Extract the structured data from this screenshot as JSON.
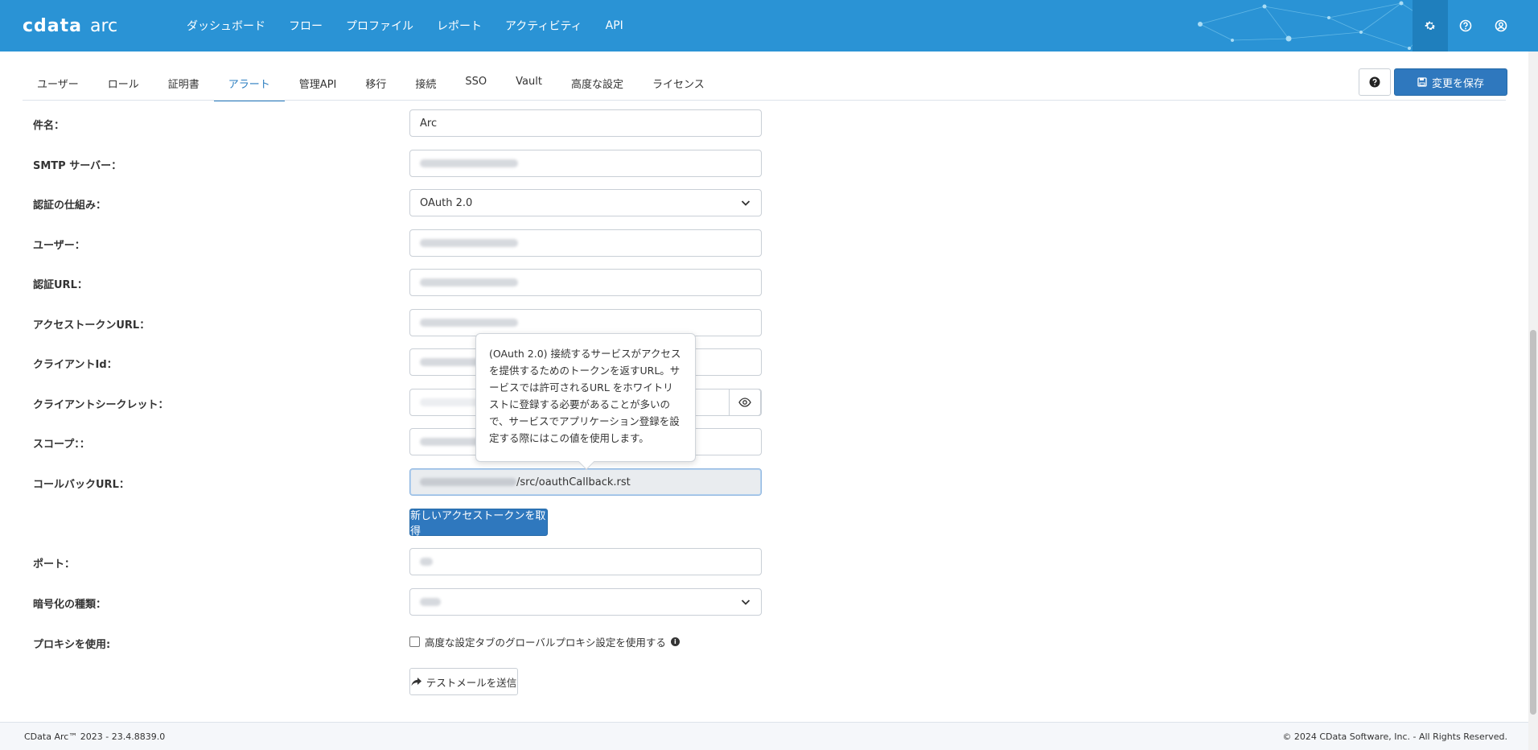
{
  "app": {
    "logo_main": "cdata",
    "logo_sub": "arc"
  },
  "nav": [
    {
      "label": "ダッシュボード"
    },
    {
      "label": "フロー"
    },
    {
      "label": "プロファイル"
    },
    {
      "label": "レポート"
    },
    {
      "label": "アクティビティ"
    },
    {
      "label": "API"
    }
  ],
  "subtabs": [
    {
      "label": "ユーザー"
    },
    {
      "label": "ロール"
    },
    {
      "label": "証明書"
    },
    {
      "label": "アラート",
      "active": true
    },
    {
      "label": "管理API"
    },
    {
      "label": "移行"
    },
    {
      "label": "接続"
    },
    {
      "label": "SSO"
    },
    {
      "label": "Vault"
    },
    {
      "label": "高度な設定"
    },
    {
      "label": "ライセンス"
    }
  ],
  "toolbar": {
    "save_label": "変更を保存"
  },
  "form": {
    "subject": {
      "label": "件名：",
      "value": "Arc"
    },
    "smtp": {
      "label": "SMTP サーバー："
    },
    "auth_mech": {
      "label": "認証の仕組み：",
      "value": "OAuth 2.0"
    },
    "user": {
      "label": "ユーザー："
    },
    "auth_url": {
      "label": "認証URL："
    },
    "token_url": {
      "label": "アクセストークンURL："
    },
    "client_id": {
      "label": "クライアントId："
    },
    "client_secret": {
      "label": "クライアントシークレット："
    },
    "scope": {
      "label": "スコープ：："
    },
    "callback_url": {
      "label": "コールバックURL：",
      "value_suffix": "/src/oauthCallback.rst"
    },
    "token_button": "新しいアクセストークンを取得",
    "port": {
      "label": "ポート："
    },
    "encryption": {
      "label": "暗号化の種類："
    },
    "proxy": {
      "label": "プロキシを使用:",
      "checkbox_label": "高度な設定タブのグローバルプロキシ設定を使用する"
    },
    "test_button": "テストメールを送信"
  },
  "tooltip": {
    "text": "(OAuth 2.0) 接続するサービスがアクセスを提供するためのトークンを返すURL。サービスでは許可されるURL をホワイトリストに登録する必要があることが多いので、サービスでアプリケーション登録を設定する際にはこの値を使用します。"
  },
  "footer": {
    "left": "CData Arc™ 2023 - 23.4.8839.0",
    "right": "© 2024 CData Software, Inc. - All Rights Reserved."
  },
  "colors": {
    "topbar": "#2a93d5",
    "primary_button": "#2f78be",
    "active_tab": "#2a7dc0"
  },
  "icons": [
    "gear-icon",
    "help-circle-icon",
    "user-circle-icon",
    "question-icon",
    "save-icon",
    "chevron-down-icon",
    "eye-icon",
    "info-icon",
    "share-arrow-icon"
  ]
}
